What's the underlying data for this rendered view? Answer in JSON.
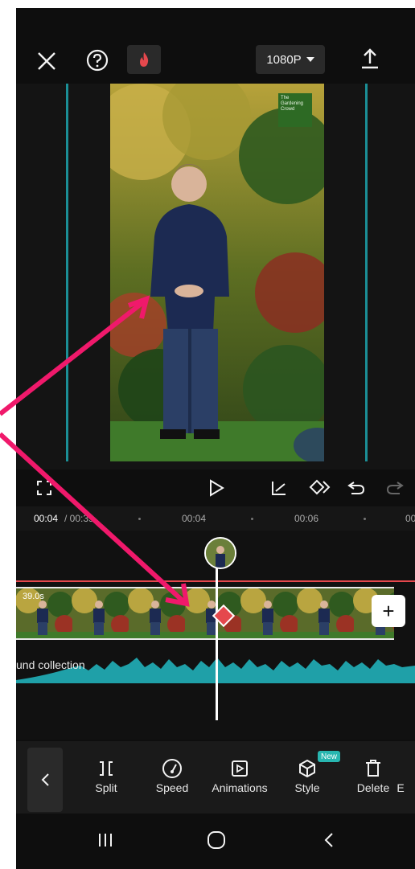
{
  "topbar": {
    "close_icon": "close-icon",
    "help_icon": "help-icon",
    "flame_icon": "flame-icon",
    "resolution": "1080P",
    "export_icon": "export-icon"
  },
  "preview": {
    "logo_text": "The Gardening Crowd"
  },
  "controls": {
    "fullscreen_icon": "fullscreen-icon",
    "play_icon": "play-icon",
    "keyframe_curve_icon": "curve-icon",
    "keyframe_add_icon": "keyframe-icon",
    "undo_icon": "undo-icon",
    "redo_icon": "redo-icon"
  },
  "timeline": {
    "current_time": "00:04",
    "total_time": "/ 00:39",
    "ticks": [
      "00:04",
      "00:06",
      "00"
    ],
    "clip_duration": "39.0s",
    "audio_label": "und collection"
  },
  "toolbar": {
    "items": [
      {
        "label": "Split",
        "icon": "split-icon"
      },
      {
        "label": "Speed",
        "icon": "speed-icon"
      },
      {
        "label": "Animations",
        "icon": "animations-icon"
      },
      {
        "label": "Style",
        "icon": "style-icon"
      },
      {
        "label": "Delete",
        "icon": "delete-icon"
      },
      {
        "label": "E",
        "icon": "edit-icon"
      }
    ],
    "new_badge": "New"
  },
  "colors": {
    "accent": "#1b8f96",
    "red": "#e5484d",
    "arrow": "#f0196b",
    "wave": "#1fa0a8"
  }
}
